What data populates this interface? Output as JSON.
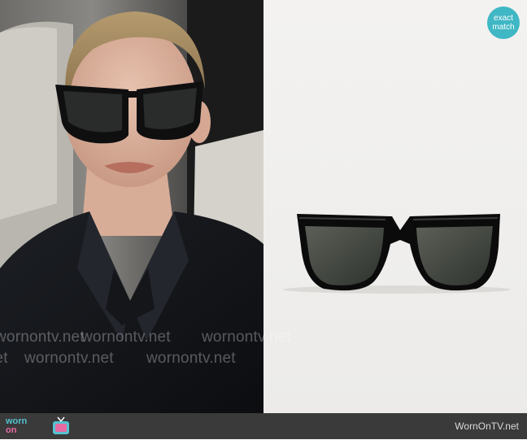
{
  "badge": {
    "line1": "exact",
    "line2": "match"
  },
  "watermarks": [
    "wornontv.net",
    "wornontv.net",
    "wornontv.net",
    "wornontv.net",
    "wornontv.net",
    "wornontv.net"
  ],
  "footer": {
    "logo_top": "worn",
    "logo_bottom": "on",
    "site_name": "WornOnTV.net"
  },
  "colors": {
    "badge": "#3fb7c4",
    "footer_bg": "#3a3a3a",
    "logo_teal": "#55c2d0",
    "logo_pink": "#e86aa3"
  }
}
